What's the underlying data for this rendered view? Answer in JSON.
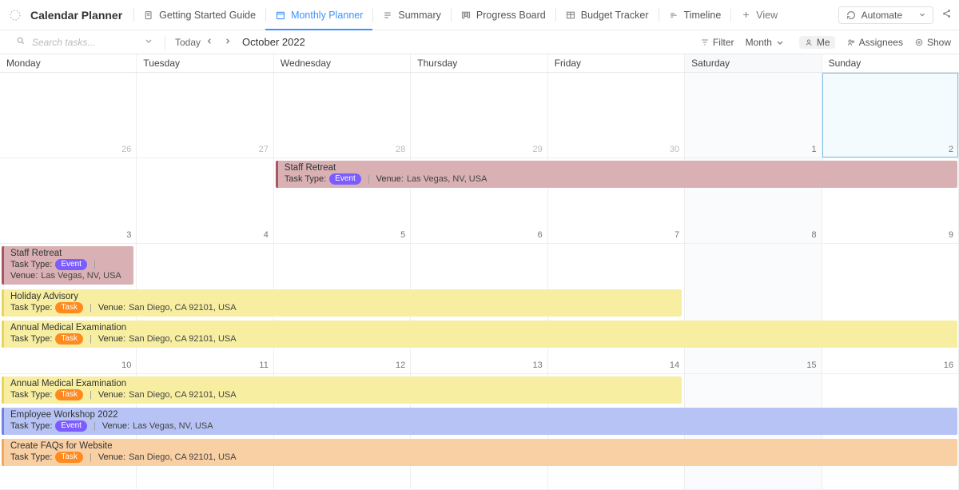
{
  "header": {
    "doc_title": "Calendar Planner",
    "tabs": [
      {
        "label": "Getting Started Guide"
      },
      {
        "label": "Monthly Planner"
      },
      {
        "label": "Summary"
      },
      {
        "label": "Progress Board"
      },
      {
        "label": "Budget Tracker"
      },
      {
        "label": "Timeline"
      }
    ],
    "add_view": "View",
    "automate": "Automate"
  },
  "toolbar": {
    "search_placeholder": "Search tasks...",
    "today_label": "Today",
    "month_title": "October 2022",
    "filter": "Filter",
    "period": "Month",
    "me": "Me",
    "assignees": "Assignees",
    "show": "Show"
  },
  "days": [
    "Monday",
    "Tuesday",
    "Wednesday",
    "Thursday",
    "Friday",
    "Saturday",
    "Sunday"
  ],
  "weeks": [
    {
      "dates": [
        "26",
        "27",
        "28",
        "29",
        "30",
        "1",
        "2"
      ]
    },
    {
      "dates": [
        "3",
        "4",
        "5",
        "6",
        "7",
        "8",
        "9"
      ]
    },
    {
      "dates": [
        "10",
        "11",
        "12",
        "13",
        "14",
        "15",
        "16"
      ]
    }
  ],
  "labels": {
    "task_type": "Task Type:",
    "venue": "Venue:",
    "event_badge": "Event",
    "task_badge": "Task"
  },
  "events": {
    "staff_retreat": {
      "title": "Staff Retreat",
      "venue": "Las Vegas, NV, USA"
    },
    "holiday_advisory": {
      "title": "Holiday Advisory",
      "venue": "San Diego, CA 92101, USA"
    },
    "annual_medical": {
      "title": "Annual Medical Examination",
      "venue": "San Diego, CA 92101, USA"
    },
    "employee_workshop": {
      "title": "Employee Workshop 2022",
      "venue": "Las Vegas, NV, USA"
    },
    "faqs": {
      "title": "Create FAQs for Website",
      "venue": "San Diego, CA 92101, USA"
    }
  }
}
